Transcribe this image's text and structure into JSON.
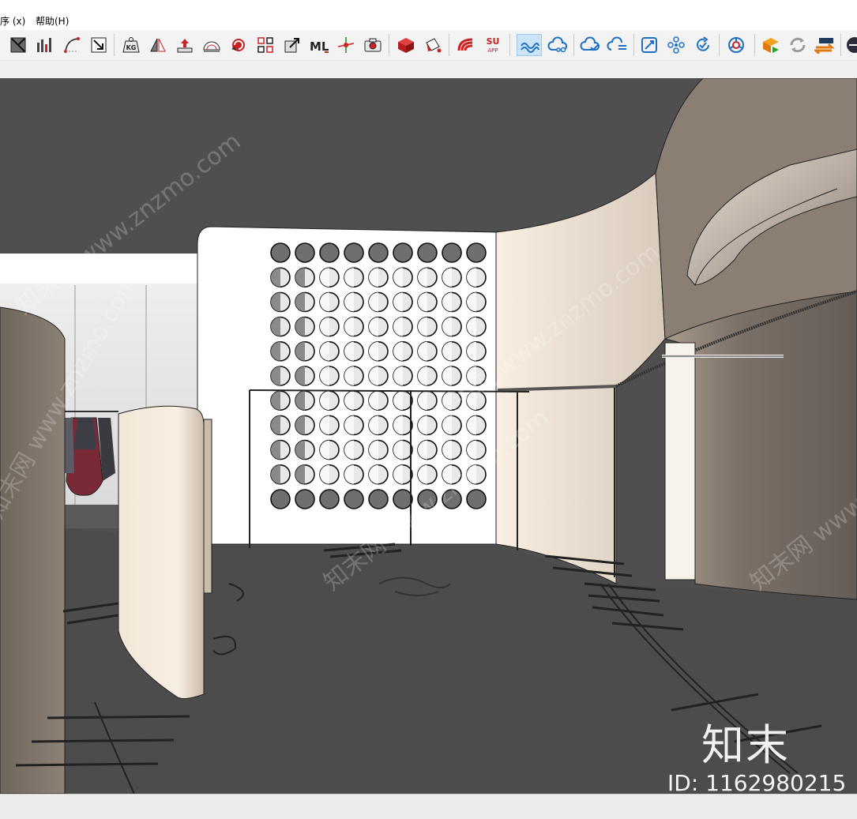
{
  "menu": {
    "items": [
      "序 (x)",
      "帮助(H)"
    ]
  },
  "toolbar": {
    "buttons": [
      {
        "icon": "xray-face-icon"
      },
      {
        "icon": "bar-graph-icon"
      },
      {
        "icon": "curve-arc-icon"
      },
      {
        "icon": "diagonal-arrow-icon"
      },
      {
        "icon": "kg-weight-icon",
        "text": "KG"
      },
      {
        "icon": "mirror-flip-icon"
      },
      {
        "icon": "push-up-icon"
      },
      {
        "icon": "protractor-icon"
      },
      {
        "icon": "rotate-red-icon"
      },
      {
        "icon": "grid-array-icon"
      },
      {
        "icon": "scale-diagonal-icon"
      },
      {
        "icon": "ml-text-icon",
        "text": "ML"
      },
      {
        "icon": "crosshair-icon"
      },
      {
        "icon": "camera-icon"
      },
      {
        "icon": "red-cube-icon"
      },
      {
        "icon": "paint-bucket-icon"
      },
      {
        "icon": "red-fan-icon"
      },
      {
        "icon": "su-app-icon",
        "text": "SU",
        "subtext": "APP"
      },
      {
        "icon": "cloud-wave-icon",
        "active": true
      },
      {
        "icon": "cloud-nodes-icon"
      },
      {
        "icon": "cloud-check-icon"
      },
      {
        "icon": "cloud-lines-icon"
      },
      {
        "icon": "frame-resize-icon"
      },
      {
        "icon": "network-circles-icon"
      },
      {
        "icon": "refresh-check-icon"
      },
      {
        "icon": "chrome-ring-icon"
      },
      {
        "icon": "box-play-icon"
      },
      {
        "icon": "sync-gray-icon"
      },
      {
        "icon": "swap-arrows-icon"
      },
      {
        "icon": "circle-dark-icon"
      }
    ]
  },
  "scene": {
    "watermarks": [
      "知末网 www.znzmo.com"
    ],
    "brand_label": "知末",
    "id_label": "ID: 1162980215",
    "colors": {
      "ceiling": "#4f4f4f",
      "floor": "#4e4e4e",
      "cream_wall": "#f4eadc",
      "taupe_wall": "#776d64",
      "white_panel": "#ffffff"
    }
  }
}
